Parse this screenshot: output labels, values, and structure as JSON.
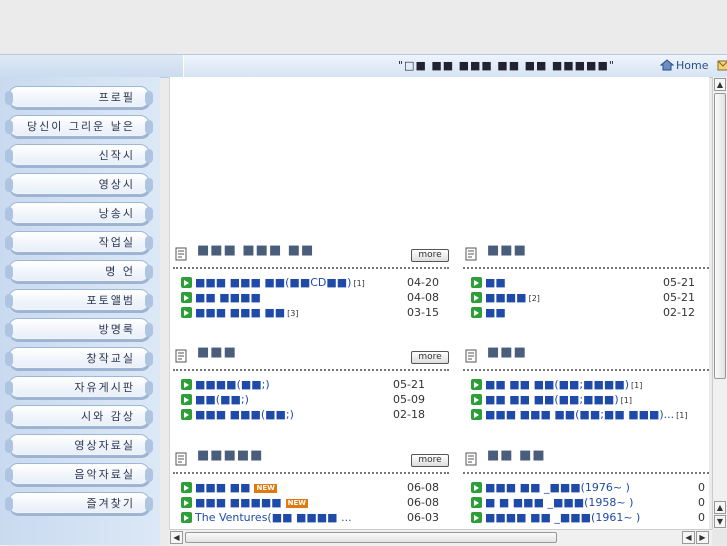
{
  "topbar": {
    "marquee": "\"□■ ■■ ■■■ ■■ ■■ ■■■■■\"",
    "home_label": "Home"
  },
  "sidebar": {
    "items": [
      {
        "label": "프로필"
      },
      {
        "label": "당신이 그리운 날은"
      },
      {
        "label": "신작시"
      },
      {
        "label": "영상시"
      },
      {
        "label": "낭송시"
      },
      {
        "label": "작업실"
      },
      {
        "label": "명  언"
      },
      {
        "label": "포토앨범"
      },
      {
        "label": "방명록"
      },
      {
        "label": "창작교실"
      },
      {
        "label": "자유게시판"
      },
      {
        "label": "시와 감상"
      },
      {
        "label": "영상자료실"
      },
      {
        "label": "음악자료실"
      },
      {
        "label": "즐겨찾기"
      }
    ]
  },
  "sections": [
    {
      "title": "■■■ ■■■ ■■",
      "more": "more",
      "rows": [
        {
          "title": "■■■ ■■■ ■■(■■CD■■)",
          "count": "[1]",
          "date": "04-20",
          "new": false
        },
        {
          "title": "■■ ■■■■",
          "count": "",
          "date": "04-08",
          "new": false
        },
        {
          "title": "■■■ ■■■ ■■",
          "count": "[3]",
          "date": "03-15",
          "new": false
        }
      ]
    },
    {
      "title": "■■■",
      "more": "more",
      "rows": [
        {
          "title": "■■",
          "count": "",
          "date": "05-21",
          "new": false
        },
        {
          "title": "■■■■",
          "count": "[2]",
          "date": "05-21",
          "new": false
        },
        {
          "title": "■■",
          "count": "",
          "date": "02-12",
          "new": false
        }
      ]
    },
    {
      "title": "■■■",
      "more": "more",
      "rows": [
        {
          "title": "■■■■(■■;)",
          "count": "",
          "date": "05-21",
          "new": false
        },
        {
          "title": "■■(■■;)",
          "count": "",
          "date": "05-09",
          "new": false
        },
        {
          "title": "■■■ ■■■(■■;)",
          "count": "",
          "date": "02-18",
          "new": false
        }
      ]
    },
    {
      "title": "■■■",
      "more": "more",
      "rows": [
        {
          "title": "■■ ■■ ■■(■■;■■■■)",
          "count": "[1]",
          "date": "",
          "new": false
        },
        {
          "title": "■■ ■■ ■■(■■;■■■)",
          "count": "[1]",
          "date": "",
          "new": false
        },
        {
          "title": "■■■ ■■■ ■■(■■;■■ ■■■)...",
          "count": "[1]",
          "date": "",
          "new": false
        }
      ]
    },
    {
      "title": "■■■■■",
      "more": "more",
      "rows": [
        {
          "title": "■■■ ■■",
          "count": "",
          "date": "06-08",
          "new": true
        },
        {
          "title": "■■■ ■■■■■",
          "count": "",
          "date": "06-08",
          "new": true
        },
        {
          "title": "The Ventures(■■ ■■■■ ...",
          "count": "",
          "date": "06-03",
          "new": false
        }
      ]
    },
    {
      "title": "■■ ■■",
      "more": "more",
      "rows": [
        {
          "title": "■■■ ■■ _■■■(1976~ )",
          "count": "",
          "date": "0",
          "new": false
        },
        {
          "title": "■ ■ ■■■ _■■■(1958~ )",
          "count": "",
          "date": "0",
          "new": false
        },
        {
          "title": "■■■■ ■■ _■■■(1961~ )",
          "count": "",
          "date": "0",
          "new": false
        }
      ]
    }
  ],
  "new_badge": "NEW"
}
